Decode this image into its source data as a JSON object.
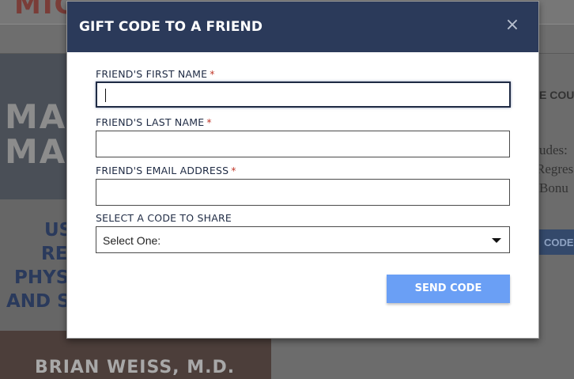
{
  "background": {
    "site_logo": "MIC",
    "book_title_lines": [
      "MA",
      "MAN"
    ],
    "book_subtitle_lines": [
      "US",
      "RE",
      "PHYS",
      "AND S"
    ],
    "book_author": "BRIAN WEISS, M.D.",
    "side_heading": "E COU",
    "side_lines": [
      "udes:",
      "Regres",
      "Bonu"
    ],
    "side_button": "CODE"
  },
  "modal": {
    "title": "GIFT CODE TO A FRIEND",
    "close_symbol": "×",
    "fields": [
      {
        "label": "FRIEND'S FIRST NAME",
        "required": "*",
        "value": ""
      },
      {
        "label": "FRIEND'S LAST NAME",
        "required": "*",
        "value": ""
      },
      {
        "label": "FRIEND'S EMAIL ADDRESS",
        "required": "*",
        "value": ""
      }
    ],
    "select": {
      "label": "SELECT A CODE TO SHARE",
      "value": "Select One:"
    },
    "submit_label": "SEND CODE"
  },
  "colors": {
    "header_bg": "#2b3a5a",
    "button_bg": "#6a9ff5",
    "required_star": "#c0392b"
  }
}
